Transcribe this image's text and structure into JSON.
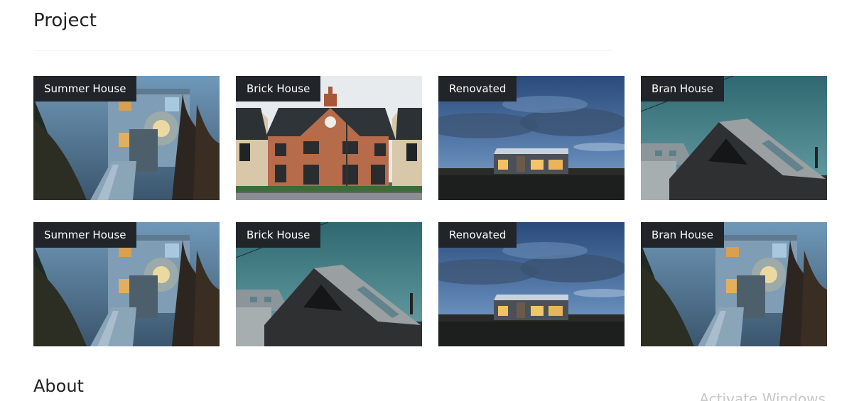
{
  "sections": {
    "project_title": "Project",
    "about_title": "About"
  },
  "projects": [
    {
      "label": "Summer House",
      "image": "summer-house-photo"
    },
    {
      "label": "Brick House",
      "image": "brick-house-photo"
    },
    {
      "label": "Renovated",
      "image": "renovated-house-photo"
    },
    {
      "label": "Bran House",
      "image": "bran-house-photo"
    },
    {
      "label": "Summer House",
      "image": "summer-house-photo"
    },
    {
      "label": "Brick House",
      "image": "bran-house-photo"
    },
    {
      "label": "Renovated",
      "image": "renovated-house-photo"
    },
    {
      "label": "Bran House",
      "image": "summer-house-photo"
    }
  ],
  "system": {
    "watermark": "Activate Windows"
  }
}
